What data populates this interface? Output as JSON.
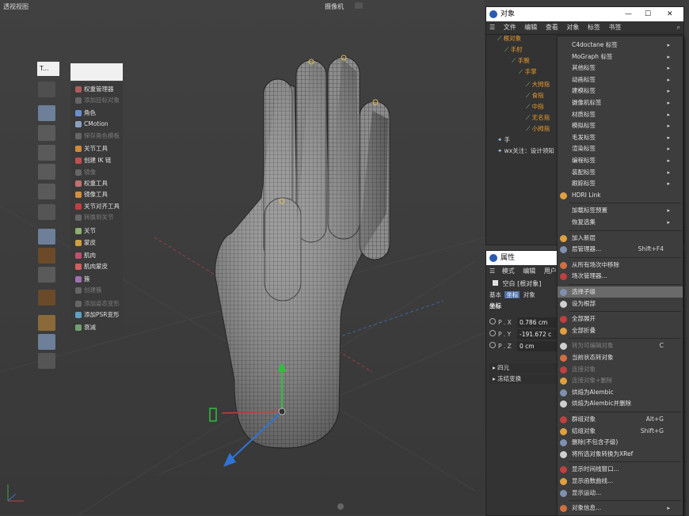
{
  "viewport": {
    "title": "透视视图",
    "camera": "摄像机",
    "camera_icon": "camera-icon"
  },
  "toolbar": {
    "top_field": "T..."
  },
  "rig_panel": {
    "items": [
      {
        "label": "权重管理器",
        "enabled": true,
        "color": "#b05a5a"
      },
      {
        "label": "添加目标对象",
        "enabled": false,
        "color": "#666"
      },
      {
        "label": "角色",
        "enabled": true,
        "color": "#6a8fd0"
      },
      {
        "label": "CMotion",
        "enabled": true,
        "color": "#8aa0c0"
      },
      {
        "label": "保存角色模板",
        "enabled": false,
        "color": "#666"
      },
      {
        "label": "关节工具",
        "enabled": true,
        "color": "#d08a3a"
      },
      {
        "label": "创建 IK 链",
        "enabled": true,
        "color": "#c05050"
      },
      {
        "label": "镜像",
        "enabled": false,
        "color": "#666"
      },
      {
        "label": "权重工具",
        "enabled": true,
        "color": "#c07070"
      },
      {
        "label": "镜像工具",
        "enabled": true,
        "color": "#d09040"
      },
      {
        "label": "关节对齐工具",
        "enabled": true,
        "color": "#c04040"
      },
      {
        "label": "转换到关节",
        "enabled": false,
        "color": "#666"
      },
      {
        "label": "关节",
        "enabled": true,
        "color": "#8fb070"
      },
      {
        "label": "蒙皮",
        "enabled": true,
        "color": "#d0a040"
      },
      {
        "label": "肌肉",
        "enabled": true,
        "color": "#c05070"
      },
      {
        "label": "肌肉蒙皮",
        "enabled": true,
        "color": "#d06060"
      },
      {
        "label": "簇",
        "enabled": true,
        "color": "#a070b0"
      },
      {
        "label": "创建簇",
        "enabled": false,
        "color": "#666"
      },
      {
        "label": "添加姿态变形",
        "enabled": false,
        "color": "#666"
      },
      {
        "label": "添加PSR变形",
        "enabled": true,
        "color": "#60a0c0"
      },
      {
        "label": "衰减",
        "enabled": true,
        "color": "#70a070"
      }
    ]
  },
  "object_manager": {
    "title": "对象",
    "window_controls": [
      "—",
      "☐",
      "✕"
    ],
    "menu": [
      "文件",
      "编辑",
      "查看",
      "对象",
      "标签",
      "书签"
    ],
    "tree": [
      {
        "label": "根对象",
        "depth": 0,
        "color": "orange"
      },
      {
        "label": "手肘",
        "depth": 1,
        "color": "orange"
      },
      {
        "label": "手腕",
        "depth": 2,
        "color": "orange"
      },
      {
        "label": "手掌",
        "depth": 3,
        "color": "orange"
      },
      {
        "label": "大拇指",
        "depth": 4,
        "color": "orange"
      },
      {
        "label": "食指",
        "depth": 4,
        "color": "orange"
      },
      {
        "label": "中指",
        "depth": 4,
        "color": "orange"
      },
      {
        "label": "无名指",
        "depth": 4,
        "color": "orange"
      },
      {
        "label": "小拇指",
        "depth": 4,
        "color": "orange"
      },
      {
        "label": "手",
        "depth": 0,
        "color": "white"
      },
      {
        "label": "wx关注：设计领知",
        "depth": 0,
        "color": "white"
      }
    ]
  },
  "context_menu": {
    "items": [
      {
        "label": "C4doctane 标签",
        "arrow": true
      },
      {
        "label": "MoGraph 标签",
        "arrow": true
      },
      {
        "label": "其他标签",
        "arrow": true
      },
      {
        "label": "动画标签",
        "arrow": true
      },
      {
        "label": "建模标签",
        "arrow": true
      },
      {
        "label": "摄像机标签",
        "arrow": true
      },
      {
        "label": "材质标签",
        "arrow": true
      },
      {
        "label": "模拟标签",
        "arrow": true
      },
      {
        "label": "毛发标签",
        "arrow": true
      },
      {
        "label": "渲染标签",
        "arrow": true
      },
      {
        "label": "编程标签",
        "arrow": true
      },
      {
        "label": "装配标签",
        "arrow": true
      },
      {
        "label": "跟踪标签",
        "arrow": true
      },
      {
        "label": "HDRI Link",
        "icon": true
      },
      {
        "sep": true
      },
      {
        "label": "加载标签预置",
        "arrow": true
      },
      {
        "label": "恢复选集",
        "arrow": true
      },
      {
        "sep": true
      },
      {
        "label": "加入新层",
        "icon": true
      },
      {
        "label": "层管理器...",
        "shortcut": "Shift+F4",
        "icon": true
      },
      {
        "sep": true
      },
      {
        "label": "从所有场次中移除",
        "icon": true
      },
      {
        "label": "场次管理器...",
        "icon": true
      },
      {
        "sep": true
      },
      {
        "label": "选择子级",
        "icon": true,
        "highlight": true
      },
      {
        "label": "设为根部",
        "icon": true
      },
      {
        "sep": true
      },
      {
        "label": "全部展开",
        "icon": true
      },
      {
        "label": "全部折叠",
        "icon": true
      },
      {
        "sep": true
      },
      {
        "label": "转为可编辑对象",
        "shortcut": "C",
        "icon": true,
        "disabled": true
      },
      {
        "label": "当前状态转对象",
        "icon": true
      },
      {
        "label": "连接对象",
        "icon": true,
        "disabled": true
      },
      {
        "label": "连接对象+删除",
        "icon": true,
        "disabled": true
      },
      {
        "label": "烘焙为Alembic",
        "icon": true
      },
      {
        "label": "烘焙为Alembic并删除",
        "icon": true
      },
      {
        "sep": true
      },
      {
        "label": "群组对象",
        "shortcut": "Alt+G",
        "icon": true
      },
      {
        "label": "结组对象",
        "shortcut": "Shift+G",
        "icon": true
      },
      {
        "label": "删除(不包含子级)",
        "icon": true
      },
      {
        "label": "将所选对象转换为XRef",
        "icon": true
      },
      {
        "sep": true
      },
      {
        "label": "显示时间线窗口...",
        "icon": true
      },
      {
        "label": "显示函数曲线...",
        "icon": true
      },
      {
        "label": "显示运动...",
        "icon": true
      },
      {
        "sep": true
      },
      {
        "label": "对象信息...",
        "icon": true,
        "arrow": true
      }
    ]
  },
  "attributes": {
    "title": "属性",
    "menu": [
      "模式",
      "编辑",
      "用户数"
    ],
    "object_name": "空白 [根对象]",
    "tabs": [
      "基本",
      "坐标",
      "对象"
    ],
    "active_tab": "坐标",
    "section": "坐标",
    "fields": [
      {
        "label": "P . X",
        "value": "0.786 cm"
      },
      {
        "label": "P . Y",
        "value": "-191.672 c"
      },
      {
        "label": "P . Z",
        "value": "0 cm"
      }
    ],
    "groups": [
      "四元",
      "冻结变换"
    ]
  }
}
